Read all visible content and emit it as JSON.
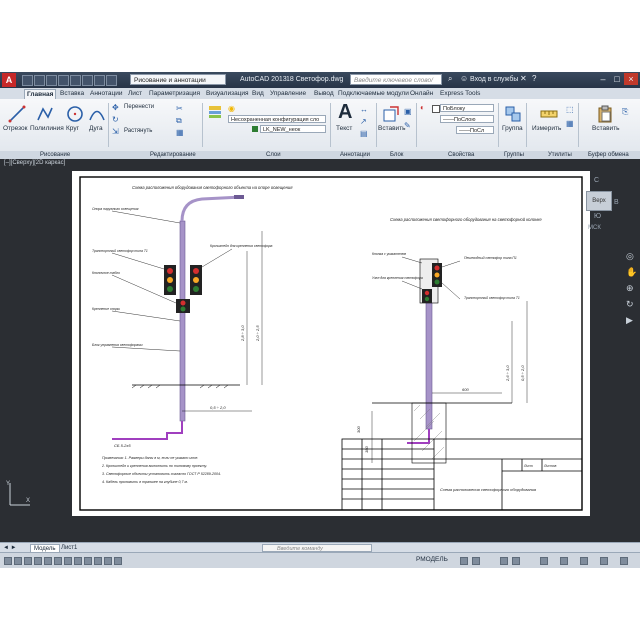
{
  "titlebar": {
    "app_logo": "A",
    "workspace": "Рисование и аннотации",
    "app_name": "AutoCAD 2013",
    "document": "18 Светофор.dwg",
    "search_placeholder": "Введите ключевое слово/фразу",
    "signin": "Вход в службы"
  },
  "tabs": [
    "Главная",
    "Вставка",
    "Аннотации",
    "Лист",
    "Параметризация",
    "Визуализация",
    "Вид",
    "Управление",
    "Вывод",
    "Подключаемые модули",
    "Онлайн",
    "Express Tools"
  ],
  "ribbon": {
    "draw_tools": [
      "Отрезок",
      "Полилиния",
      "Круг",
      "Дуга"
    ],
    "modify_tools": [
      "Перенести",
      "Растянуть"
    ],
    "layer_state": "Несохраненная конфигурация сло",
    "layer_name": "LK_NEW_неок",
    "annotation_tool": "Текст",
    "insert_tool": "Вставить",
    "properties": {
      "color": "ПоБлоку",
      "linetype": "——ПоСлою",
      "lineweight": "——ПоСл"
    },
    "groups_tool": "Группа",
    "utilities_tool": "Измерить",
    "clipboard_tool": "Вставить"
  },
  "panels": [
    "Рисование",
    "Редактирование",
    "Слои",
    "Аннотации",
    "Блок",
    "Свойства",
    "Группы",
    "Утилиты",
    "Буфер обмена"
  ],
  "viewport": {
    "label": "[–][Сверху][2D каркас]",
    "viewcube": {
      "face": "Верх",
      "north": "С",
      "east": "В",
      "south": "Ю",
      "ucs": "МСК"
    }
  },
  "drawing": {
    "left_title": "Схема расположения оборудования светофорного объекта на опоре освещения",
    "right_title": "Схема расположения светофорного оборудования на светофорной колонке",
    "left_labels": [
      "Опора наружного освещения",
      "Транспортный светофор типа Т1",
      "Кронштейн для крепления светофора",
      "Кнопочное табло",
      "Крепление опоры",
      "Блок управления светофорами"
    ],
    "right_labels": [
      "Кнопка с указателем",
      "Узел для крепления светофора",
      "Транспортный светофор типа Т1",
      "Пешеходный светофор типа П1"
    ],
    "dims": [
      "2,8 ÷ 3,0",
      "2,0 ÷ 2,5",
      "0,5 ÷ 2,0",
      "2,6 ÷ 3,0",
      "0,5 ÷ 2,0",
      "180",
      "300",
      "600"
    ],
    "cable": "СБ 5-2x5",
    "notes": [
      "Примечания: 1. Размеры даны в м, если не указано иное.",
      "2. Кронштейн и крепления выполнить по типовому проекту.",
      "3. Светофорные объекты установить согласно ГОСТ Р 52289-2004.",
      "4. Кабель проложить в траншее на глубине 0,7 м."
    ],
    "stamp_title": "Схема расположения светофорного оборудования",
    "stamp_sheet": "Лист",
    "stamp_sheets": "Листов"
  },
  "layout_tabs": [
    "Модель",
    "Лист1"
  ],
  "command_placeholder": "Введите команду",
  "status": {
    "coords": "РМОДЕЛЬ"
  }
}
